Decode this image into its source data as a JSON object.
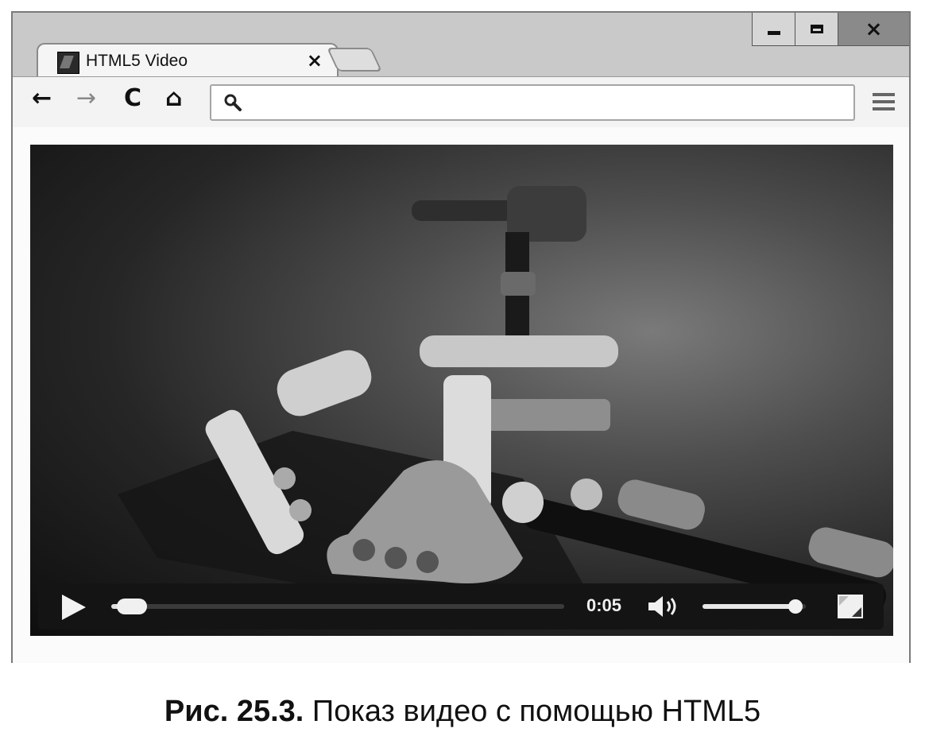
{
  "browser": {
    "tab": {
      "title": "HTML5 Video",
      "close_glyph": "×"
    },
    "window_controls": {
      "minimize": "minimize",
      "maximize": "maximize",
      "close_glyph": "×"
    },
    "toolbar": {
      "back_glyph": "←",
      "forward_glyph": "→",
      "reload_glyph": "C",
      "home_glyph": "⌂",
      "address_value": ""
    }
  },
  "video_player": {
    "current_time": "0:05",
    "progress_fraction": 0.03,
    "volume_fraction": 0.9,
    "icons": [
      "play-icon",
      "volume-icon",
      "fullscreen-icon"
    ]
  },
  "caption": {
    "label": "Рис. 25.3.",
    "text": "Показ видео с помощью HTML5"
  }
}
